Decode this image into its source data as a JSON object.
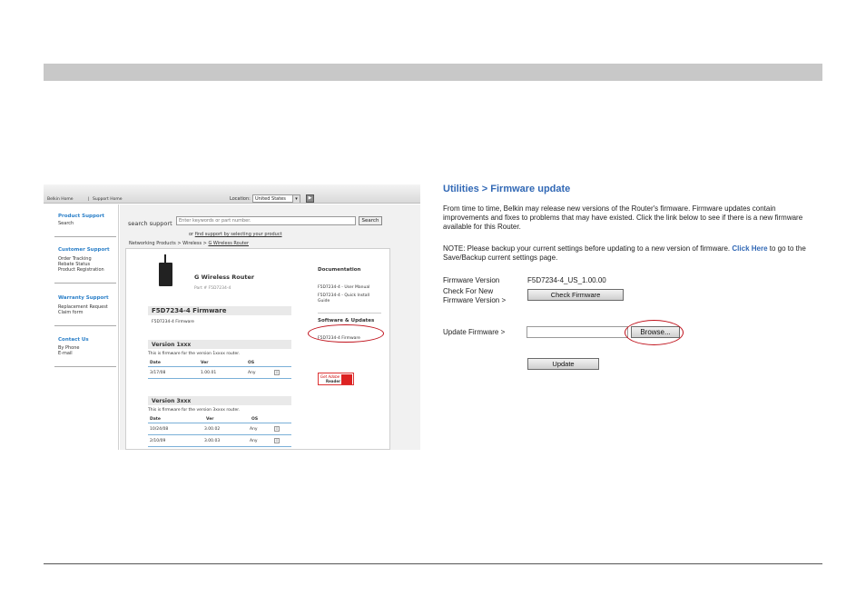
{
  "left": {
    "topnav": {
      "belkin_home": "Belkin Home",
      "separator": "|",
      "support_home": "Support Home",
      "location_label": "Location:",
      "location_value": "United States",
      "location_arrow": "▾",
      "go": "▶"
    },
    "sidebar": {
      "sections": [
        {
          "title": "Product Support",
          "items": [
            "Search"
          ]
        },
        {
          "title": "Customer Support",
          "items": [
            "Order Tracking",
            "Rebate Status",
            "Product Registration"
          ]
        },
        {
          "title": "Warranty Support",
          "items": [
            "Replacement Request",
            "Claim form"
          ]
        },
        {
          "title": "Contact Us",
          "items": [
            "By Phone",
            "E-mail"
          ]
        }
      ]
    },
    "search": {
      "label": "search support",
      "placeholder": "Enter keywords or part number.",
      "button": "Search",
      "find_prefix": "or",
      "find_link": "find support by selecting your product"
    },
    "breadcrumb": {
      "prefix": "Networking Products > Wireless > ",
      "current": "G Wireless Router"
    },
    "product": {
      "title": "G Wireless Router",
      "part": "Part # F5D7234-4"
    },
    "firmware": {
      "heading": "F5D7234-4 Firmware",
      "sub": "F5D7234-4 Firmware"
    },
    "versions": [
      {
        "title": "Version 1xxx",
        "note": "This is firmware for the version 1xxxx router.",
        "headers": [
          "Date",
          "Ver",
          "OS"
        ],
        "rows": [
          {
            "date": "3/17/08",
            "ver": "1.00.01",
            "os": "Any"
          }
        ]
      },
      {
        "title": "Version 3xxx",
        "note": "This is firmware for the version 3xxxx router.",
        "headers": [
          "Date",
          "Ver",
          "OS"
        ],
        "rows": [
          {
            "date": "10/24/08",
            "ver": "3.00.02",
            "os": "Any"
          },
          {
            "date": "2/10/09",
            "ver": "3.00.03",
            "os": "Any"
          }
        ]
      }
    ],
    "download_glyph": "⇩",
    "documentation": {
      "heading": "Documentation",
      "items": [
        "F5D7234-4 - User Manual",
        "F5D7234-4 - Quick Install Guide"
      ]
    },
    "software": {
      "heading": "Software & Updates",
      "item": "F5D7234-4 Firmware"
    },
    "adobe": {
      "get": "Get Adobe",
      "reader": "Reader"
    }
  },
  "right": {
    "title": "Utilities > Firmware update",
    "desc": "From time to time, Belkin may release new versions of the Router's firmware. Firmware updates contain improvements and fixes to problems that may have existed. Click the link below to see if there is a new firmware available for this Router.",
    "note_prefix": "NOTE: Please backup your current settings before updating to a new version of firmware. ",
    "note_link": "Click Here",
    "note_suffix": " to go to the Save/Backup current settings page.",
    "fw_version_label": "Firmware Version",
    "fw_version_value": "F5D7234-4_US_1.00.00",
    "check_label_1": "Check For New",
    "check_label_2": "Firmware Version >",
    "check_button": "Check Firmware",
    "update_label": "Update Firmware >",
    "file_value": "",
    "browse_button": "Browse...",
    "update_button": "Update"
  },
  "colors": {
    "accent": "#3168b5",
    "highlight": "#c0121c",
    "header_bar": "#c8c8c8"
  }
}
